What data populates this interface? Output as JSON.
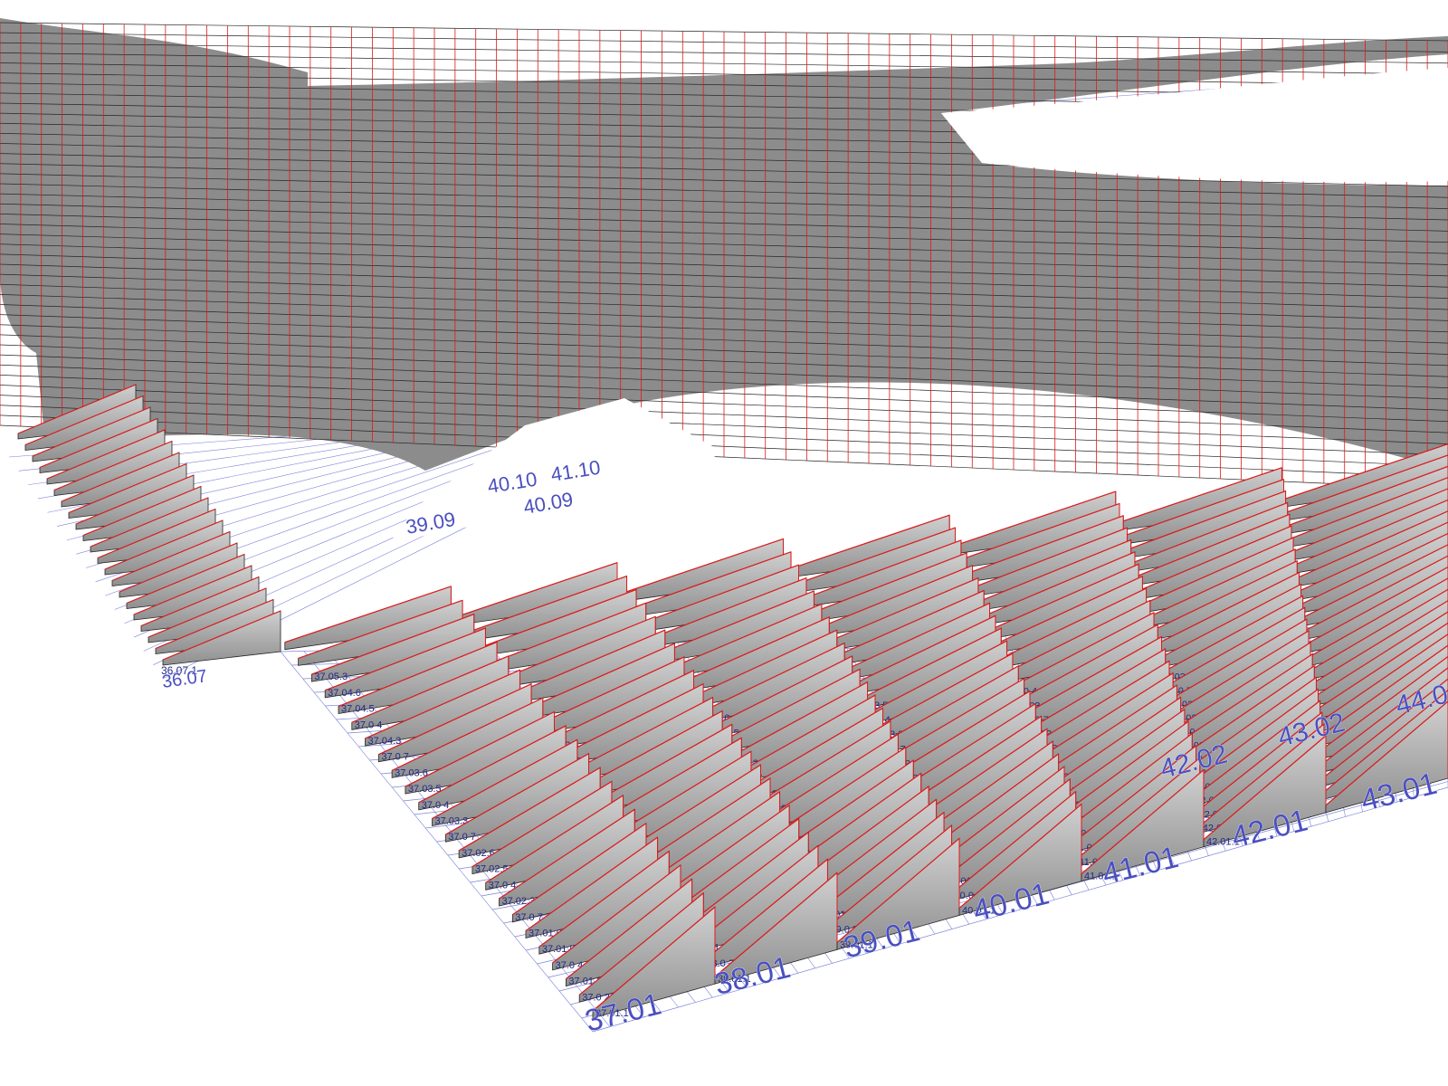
{
  "colors": {
    "background": "#ffffff",
    "grid_line": "#7d83d8",
    "grid_label": "#4a4fc0",
    "fin_top": "#d0d0d0",
    "fin_bottom": "#8f8f8f",
    "fin_edge": "#262626",
    "panel_outline": "#e01a1a",
    "panel_label": "#232a8a"
  },
  "grid_labels_front": [
    "37.01",
    "38.01",
    "39.01",
    "40.01",
    "41.01",
    "42.01",
    "43.01"
  ],
  "grid_labels_second": [
    "42.02",
    "43.02",
    "44.0"
  ],
  "grid_labels_back_row_10": [
    "40.10",
    "41.10"
  ],
  "grid_labels_back_row_09": [
    "39.09",
    "40.09"
  ],
  "grid_labels_misc": [
    "36.07",
    "39.01.1",
    "38.01.1",
    "37.01.1",
    "41.01.1",
    "42.01.1",
    "40.01.1"
  ],
  "panel_labels_column_37": [
    "37.01.1",
    "37.0 2",
    "37.01.3",
    "37.0 4",
    "37.01.5",
    "37.01.6",
    "37.0 7",
    "37.02.3",
    "37.0 4",
    "37.02.5",
    "37.02.6",
    "37.0 7",
    "37.03.3",
    "37.0 4",
    "37.03.5",
    "37.03.6",
    "37.0 7",
    "37.04.3",
    "37.0 4",
    "37.04.5",
    "37.04.6",
    "37.05.3"
  ],
  "panel_labels_column_38": [
    "38.01.1",
    "38.0 2",
    "38.01.3",
    "38.0 4",
    "38.01.5",
    "38.01.6",
    "38.0 7",
    "38.02.3",
    "38.0 4",
    "38.02.5",
    "38.02.6",
    "38.0 7",
    "38.03.3",
    "38.0 4",
    "38.03.5",
    "38.03.6"
  ],
  "panel_labels_column_39": [
    "39.01.1",
    "39.0 2",
    "39.01.3",
    "39.0 4",
    "39.01.5",
    "39.01.6",
    "39.0 7",
    "39.02.3",
    "39.0 4",
    "39.02.5",
    "39.02.6",
    "39.0 7",
    "39.03.3",
    "39.0 4",
    "39.03.5",
    "39.03.6"
  ],
  "panel_labels_column_40": [
    "40.01.1",
    "40.0 2",
    "40.01.3",
    "40.0 4",
    "40.01.5",
    "40.01.6",
    "40.0 7",
    "40.02.3",
    "40.0 4",
    "40.02.5",
    "40.02.6",
    "40.0 7",
    "40.03.3",
    "40.0 4",
    "40.03.5"
  ],
  "panel_labels_column_41": [
    "41.01.1",
    "41.0 2",
    "41.01.3",
    "41.0 4",
    "41.01.5",
    "41.01.6",
    "41.0 7",
    "41.02.3",
    "41.0 4",
    "41.02.5",
    "41.02.6",
    "41.0 7",
    "41.03.3",
    "41.0 4"
  ],
  "panel_labels_column_42": [
    "42.01.1",
    "42.0 2",
    "42.01.3",
    "42.0 4",
    "42.01.5",
    "42.01.6",
    "42.0 7",
    "42.02.3",
    "42.0 4",
    "42.02.5",
    "42.02.6",
    "42.0 7",
    "42.03.3"
  ],
  "panel_labels_column_36": [
    "36.07.1"
  ]
}
